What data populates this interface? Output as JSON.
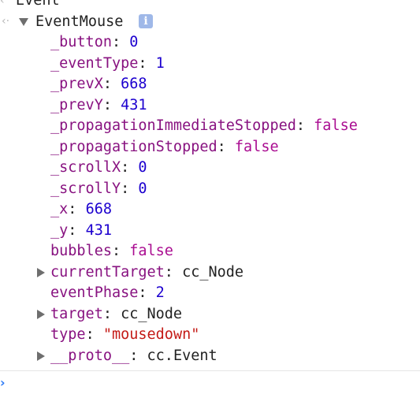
{
  "console": {
    "previous_line": {
      "marker": "‹",
      "label": "Event"
    },
    "result": {
      "marker": "‹·",
      "title": "EventMouse",
      "info_icon": "info-icon",
      "info_glyph": "i",
      "expanded": true,
      "properties": [
        {
          "key": "_button",
          "value": "0",
          "type": "number",
          "expandable": false
        },
        {
          "key": "_eventType",
          "value": "1",
          "type": "number",
          "expandable": false
        },
        {
          "key": "_prevX",
          "value": "668",
          "type": "number",
          "expandable": false
        },
        {
          "key": "_prevY",
          "value": "431",
          "type": "number",
          "expandable": false
        },
        {
          "key": "_propagationImmediateStopped",
          "value": "false",
          "type": "bool",
          "expandable": false
        },
        {
          "key": "_propagationStopped",
          "value": "false",
          "type": "bool",
          "expandable": false
        },
        {
          "key": "_scrollX",
          "value": "0",
          "type": "number",
          "expandable": false
        },
        {
          "key": "_scrollY",
          "value": "0",
          "type": "number",
          "expandable": false
        },
        {
          "key": "_x",
          "value": "668",
          "type": "number",
          "expandable": false
        },
        {
          "key": "_y",
          "value": "431",
          "type": "number",
          "expandable": false
        },
        {
          "key": "bubbles",
          "value": "false",
          "type": "bool",
          "expandable": false
        },
        {
          "key": "currentTarget",
          "value": "cc_Node",
          "type": "object",
          "expandable": true
        },
        {
          "key": "eventPhase",
          "value": "2",
          "type": "number",
          "expandable": false
        },
        {
          "key": "target",
          "value": "cc_Node",
          "type": "object",
          "expandable": true
        },
        {
          "key": "type",
          "value": "\"mousedown\"",
          "type": "string",
          "expandable": false
        },
        {
          "key": "__proto__",
          "value": "cc.Event",
          "type": "object",
          "expandable": true
        }
      ]
    },
    "prompt": {
      "caret": "›",
      "value": "",
      "placeholder": ""
    }
  },
  "colors": {
    "key": "#881280",
    "number": "#1c00cf",
    "bool": "#aa0d91",
    "string": "#c41a16",
    "prompt_caret": "#2f7cf6",
    "info_badge": "#9fb8e8"
  }
}
